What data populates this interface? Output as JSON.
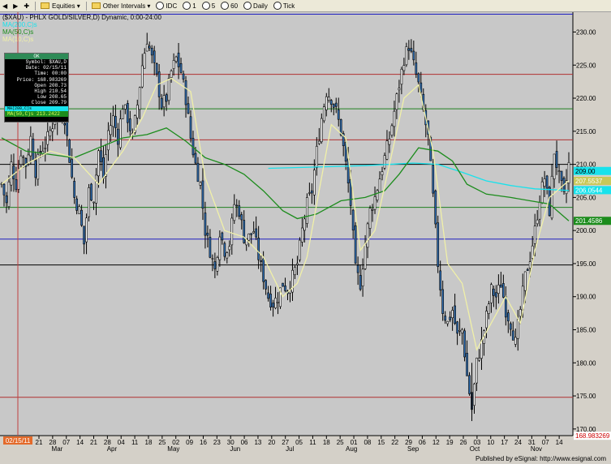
{
  "toolbar": {
    "nav_back": "◀",
    "nav_fwd": "▶",
    "nav_add": "✚",
    "equities": "Equities",
    "other_intervals": "Other Intervals",
    "idc": "IDC",
    "i1": "1",
    "i5": "5",
    "i60": "60",
    "daily": "Daily",
    "tick": "Tick"
  },
  "chart_data": {
    "type": "candlestick",
    "title": "($XAU) - PHLX GOLD/SILVER,D) Dynamic, 0:00-24:00",
    "legend": [
      "MA(200,C)s",
      "MA(50,C)s",
      "MA(10,C)s"
    ],
    "ylim": [
      169,
      233
    ],
    "y_ticks": [
      170,
      175,
      180,
      185,
      190,
      195,
      200,
      205,
      210,
      215,
      220,
      225,
      230
    ],
    "y_tick_labels": [
      "170.00",
      "175.00",
      "180.00",
      "185.00",
      "190.00",
      "195.00",
      "200.00",
      "205.00",
      "210.00",
      "215.00",
      "220.00",
      "225.00",
      "230.00"
    ],
    "x_day_labels": [
      "21",
      "28",
      "07",
      "14",
      "21",
      "28",
      "04",
      "11",
      "18",
      "25",
      "02",
      "09",
      "16",
      "23",
      "30",
      "06",
      "13",
      "20",
      "27",
      "05",
      "11",
      "18",
      "25",
      "01",
      "08",
      "15",
      "22",
      "29",
      "06",
      "12",
      "19",
      "26",
      "03",
      "10",
      "17",
      "24",
      "31",
      "07",
      "14"
    ],
    "x_month_labels": [
      "Mar",
      "Apr",
      "May",
      "Jun",
      "Jul",
      "Aug",
      "Sep",
      "Oct",
      "Nov"
    ],
    "cursor_date": "02/15/11",
    "horizontal_lines": [
      {
        "y": 232.7,
        "color": "#2020c0"
      },
      {
        "y": 223.6,
        "color": "#b03030"
      },
      {
        "y": 218.4,
        "color": "#208020"
      },
      {
        "y": 213.7,
        "color": "#b03030"
      },
      {
        "y": 210.0,
        "color": "#000000"
      },
      {
        "y": 203.5,
        "color": "#208020"
      },
      {
        "y": 198.7,
        "color": "#2020c0"
      },
      {
        "y": 194.8,
        "color": "#000000"
      },
      {
        "y": 174.8,
        "color": "#b03030"
      }
    ],
    "price_labels": [
      {
        "value": 209.0,
        "text": "209.00",
        "bg": "#18e2ec",
        "fg": "#000"
      },
      {
        "value": 207.5,
        "text": "207.5537",
        "bg": "#c8c85a",
        "fg": "#fff"
      },
      {
        "value": 206.1,
        "text": "206.0544",
        "bg": "#18e2ec",
        "fg": "#fff"
      },
      {
        "value": 201.46,
        "text": "201.4586",
        "bg": "#1c8c1c",
        "fg": "#fff"
      },
      {
        "value": 168.98,
        "text": "168.983269",
        "bg": "#ffffff",
        "fg": "#c00"
      }
    ],
    "close_path": [
      [
        0,
        207
      ],
      [
        2,
        204
      ],
      [
        4,
        210
      ],
      [
        6,
        207
      ],
      [
        8,
        212
      ],
      [
        10,
        210
      ],
      [
        12,
        214
      ],
      [
        14,
        209
      ],
      [
        16,
        212
      ],
      [
        18,
        213
      ],
      [
        20,
        215
      ],
      [
        22,
        217
      ],
      [
        24,
        218
      ],
      [
        26,
        217
      ],
      [
        28,
        211
      ],
      [
        30,
        205
      ],
      [
        32,
        203
      ],
      [
        34,
        198
      ],
      [
        36,
        206
      ],
      [
        38,
        205
      ],
      [
        40,
        212
      ],
      [
        42,
        208
      ],
      [
        44,
        215
      ],
      [
        46,
        217
      ],
      [
        48,
        214
      ],
      [
        50,
        219
      ],
      [
        52,
        217
      ],
      [
        54,
        214
      ],
      [
        56,
        219
      ],
      [
        58,
        225
      ],
      [
        60,
        229
      ],
      [
        62,
        226
      ],
      [
        64,
        223
      ],
      [
        66,
        219
      ],
      [
        68,
        220
      ],
      [
        70,
        224
      ],
      [
        72,
        226
      ],
      [
        74,
        224
      ],
      [
        76,
        220
      ],
      [
        78,
        214
      ],
      [
        80,
        210
      ],
      [
        82,
        207
      ],
      [
        84,
        200
      ],
      [
        86,
        197
      ],
      [
        88,
        194
      ],
      [
        90,
        200
      ],
      [
        92,
        197
      ],
      [
        94,
        198
      ],
      [
        96,
        204
      ],
      [
        98,
        203
      ],
      [
        100,
        199
      ],
      [
        102,
        199
      ],
      [
        104,
        200
      ],
      [
        106,
        196
      ],
      [
        108,
        193
      ],
      [
        110,
        190
      ],
      [
        112,
        189
      ],
      [
        114,
        190
      ],
      [
        116,
        192
      ],
      [
        118,
        191
      ],
      [
        120,
        193
      ],
      [
        122,
        195
      ],
      [
        124,
        200
      ],
      [
        126,
        204
      ],
      [
        128,
        206
      ],
      [
        130,
        212
      ],
      [
        132,
        217
      ],
      [
        134,
        221
      ],
      [
        136,
        220
      ],
      [
        138,
        218
      ],
      [
        140,
        215
      ],
      [
        142,
        210
      ],
      [
        144,
        204
      ],
      [
        146,
        194
      ],
      [
        148,
        192
      ],
      [
        150,
        198
      ],
      [
        152,
        203
      ],
      [
        154,
        205
      ],
      [
        156,
        208
      ],
      [
        158,
        211
      ],
      [
        160,
        214
      ],
      [
        162,
        218
      ],
      [
        164,
        222
      ],
      [
        166,
        226
      ],
      [
        168,
        228
      ],
      [
        170,
        225
      ],
      [
        172,
        222
      ],
      [
        174,
        218
      ],
      [
        176,
        214
      ],
      [
        178,
        205
      ],
      [
        180,
        195
      ],
      [
        182,
        188
      ],
      [
        184,
        186
      ],
      [
        186,
        188
      ],
      [
        188,
        184
      ],
      [
        190,
        185
      ],
      [
        192,
        178
      ],
      [
        194,
        173
      ],
      [
        196,
        180
      ],
      [
        198,
        183
      ],
      [
        200,
        187
      ],
      [
        202,
        191
      ],
      [
        204,
        190
      ],
      [
        206,
        192
      ],
      [
        208,
        188
      ],
      [
        210,
        186
      ],
      [
        212,
        183
      ],
      [
        214,
        188
      ],
      [
        216,
        193
      ],
      [
        218,
        196
      ],
      [
        220,
        200
      ],
      [
        222,
        205
      ],
      [
        224,
        208
      ],
      [
        226,
        203
      ],
      [
        228,
        212
      ],
      [
        230,
        208
      ],
      [
        232,
        205
      ],
      [
        234,
        210
      ]
    ],
    "ma_series": [
      {
        "name": "MA(200,C)s",
        "color": "#18e2ec",
        "start": 110,
        "points": [
          [
            110,
            209.4
          ],
          [
            130,
            209.6
          ],
          [
            150,
            209.8
          ],
          [
            170,
            210.2
          ],
          [
            180,
            210.0
          ],
          [
            190,
            208.8
          ],
          [
            200,
            207.5
          ],
          [
            210,
            206.8
          ],
          [
            220,
            206.3
          ],
          [
            234,
            206.05
          ]
        ]
      },
      {
        "name": "MA(50,C)s",
        "color": "#1c8c1c",
        "start": 0,
        "points": [
          [
            0,
            214
          ],
          [
            10,
            212
          ],
          [
            20,
            211.5
          ],
          [
            30,
            211.0
          ],
          [
            40,
            212.5
          ],
          [
            50,
            214
          ],
          [
            60,
            214.5
          ],
          [
            68,
            215.5
          ],
          [
            76,
            213.5
          ],
          [
            84,
            211.0
          ],
          [
            92,
            210.0
          ],
          [
            100,
            208.5
          ],
          [
            108,
            206.0
          ],
          [
            116,
            203.0
          ],
          [
            122,
            201.8
          ],
          [
            130,
            202.5
          ],
          [
            140,
            204.5
          ],
          [
            150,
            205.0
          ],
          [
            158,
            206.0
          ],
          [
            164,
            208.5
          ],
          [
            172,
            212.5
          ],
          [
            180,
            212.0
          ],
          [
            186,
            210.5
          ],
          [
            192,
            207.0
          ],
          [
            200,
            205.5
          ],
          [
            210,
            205.0
          ],
          [
            218,
            204.5
          ],
          [
            226,
            204.0
          ],
          [
            234,
            201.46
          ]
        ]
      },
      {
        "name": "MA(10,C)s",
        "color": "#f0f0a8",
        "start": 0,
        "points": [
          [
            0,
            207
          ],
          [
            10,
            210
          ],
          [
            20,
            212
          ],
          [
            30,
            211
          ],
          [
            40,
            207
          ],
          [
            50,
            212
          ],
          [
            58,
            217
          ],
          [
            64,
            222
          ],
          [
            70,
            223
          ],
          [
            78,
            221
          ],
          [
            84,
            208
          ],
          [
            92,
            200
          ],
          [
            100,
            199
          ],
          [
            108,
            196
          ],
          [
            116,
            190
          ],
          [
            122,
            192
          ],
          [
            126,
            196
          ],
          [
            130,
            204
          ],
          [
            136,
            216
          ],
          [
            142,
            214
          ],
          [
            148,
            197
          ],
          [
            154,
            200
          ],
          [
            160,
            210
          ],
          [
            166,
            220
          ],
          [
            172,
            222
          ],
          [
            178,
            212
          ],
          [
            184,
            195
          ],
          [
            190,
            192
          ],
          [
            196,
            182
          ],
          [
            202,
            186
          ],
          [
            208,
            190
          ],
          [
            214,
            186
          ],
          [
            220,
            197
          ],
          [
            226,
            205
          ],
          [
            234,
            207.55
          ]
        ]
      }
    ]
  },
  "infobox": {
    "header": "OK",
    "rows": [
      "Symbol: $XAU,D",
      "Date: 02/15/11",
      "Time: 00:00",
      "Price: 168.983269",
      "Open 208.73",
      "High 210.54",
      "Low 208.65",
      "Close 209.79"
    ],
    "ma200_row": "MA(200,C)s",
    "ma50_row": "MA(50,C)s 213.2422"
  },
  "status": {
    "text": "Published by eSignal: http://www.esignal.com"
  },
  "colors": {
    "bg": "#c8c8c8",
    "panel": "#d4d0c8",
    "candle": "#000000",
    "candle_up": "#ffffff",
    "candle_down": "#2f6db0"
  }
}
